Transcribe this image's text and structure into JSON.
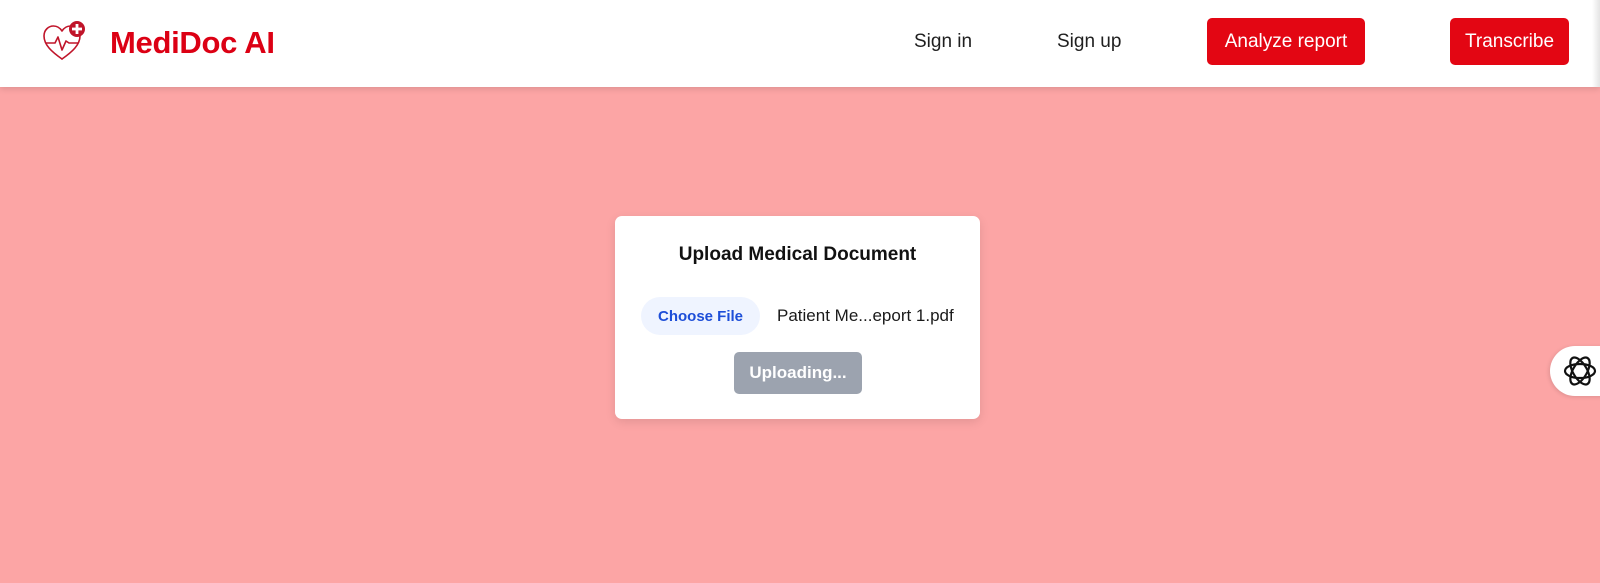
{
  "brand": {
    "name": "MediDoc AI",
    "icon": "heart-pulse-plus-icon",
    "color": "#dc0014"
  },
  "nav": {
    "sign_in": "Sign in",
    "sign_up": "Sign up",
    "analyze_button": "Analyze report",
    "transcribe_button": "Transcribe",
    "button_color": "#e30613"
  },
  "upload": {
    "title": "Upload Medical Document",
    "choose_file_label": "Choose File",
    "file_name": "Patient Me...eport 1.pdf",
    "status_button_label": "Uploading..."
  },
  "assistant": {
    "icon": "assistant-knot-icon"
  },
  "colors": {
    "background": "#fca5a5",
    "choose_file_text": "#1d4ed8",
    "upload_button_disabled": "#9ca3af"
  }
}
